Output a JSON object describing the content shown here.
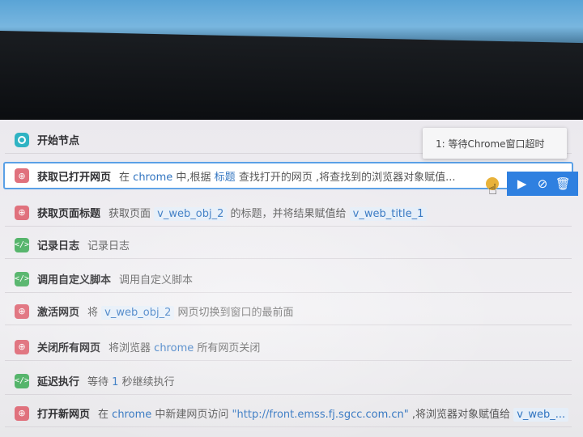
{
  "tooltip": {
    "text": "1: 等待Chrome窗口超时"
  },
  "rows": [
    {
      "name": "开始节点"
    },
    {
      "name": "获取已打开网页",
      "p1": "在",
      "hl1": "chrome",
      "p2": "中,根据",
      "hl2": "标题",
      "p3": "查找打开的网页 ,将查找到的浏览器对象赋值..."
    },
    {
      "name": "获取页面标题",
      "p1": "获取页面",
      "v1": "v_web_obj_2",
      "p2": "的标题，并将结果赋值给",
      "v2": "v_web_title_1"
    },
    {
      "name": "记录日志",
      "p1": "记录日志"
    },
    {
      "name": "调用自定义脚本",
      "p1": "调用自定义脚本"
    },
    {
      "name": "激活网页",
      "p1": "将",
      "v1": "v_web_obj_2",
      "p2": "网页切换到窗口的最前面"
    },
    {
      "name": "关闭所有网页",
      "p1": "将浏览器",
      "hl1": "chrome",
      "p2": "所有网页关闭"
    },
    {
      "name": "延迟执行",
      "p1": "等待",
      "hl1": "1",
      "p2": "秒继续执行"
    },
    {
      "name": "打开新网页",
      "p1": "在",
      "hl1": "chrome",
      "p2": "中新建网页访问",
      "hl2": "\"http://front.emss.fj.sgcc.com.cn\"",
      "p3": ",将浏览器对象赋值给",
      "v1": "v_web_..."
    }
  ],
  "icons": {
    "start": "start-node-icon",
    "web": "web-icon",
    "code": "code-icon",
    "run": "play-icon",
    "disable": "disable-icon",
    "delete": "trash-icon",
    "warning": "warning-icon",
    "cursor": "hand-cursor-icon"
  },
  "colors": {
    "accent": "#2f80e0",
    "start": "#2fb3c3",
    "web": "#e0717d",
    "code": "#54b46a",
    "variable": "#2f73c0",
    "warning": "#e8b23a"
  }
}
